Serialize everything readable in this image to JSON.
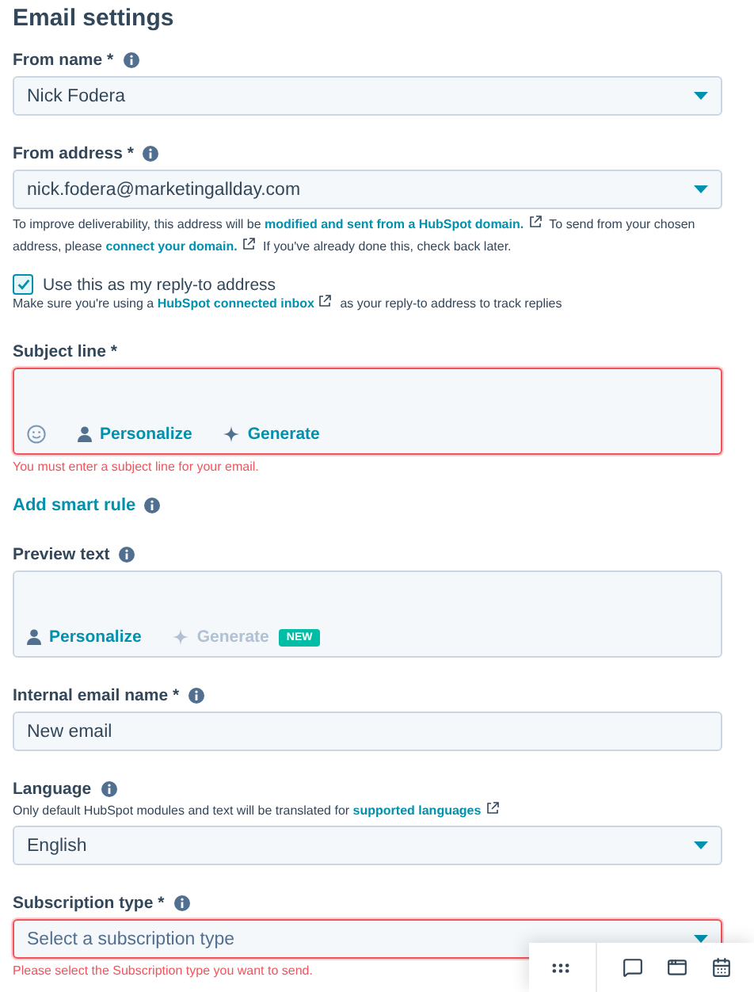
{
  "title": "Email settings",
  "sections": [
    {
      "kind": "select",
      "label": "From name *",
      "info": true,
      "value": "Nick Fodera",
      "invalid": false
    },
    {
      "kind": "select",
      "label": "From address *",
      "info": true,
      "value": "nick.fodera@marketingallday.com",
      "invalid": false,
      "help": [
        {
          "kind": "text",
          "text": "To improve deliverability, this address will be "
        },
        {
          "kind": "link",
          "text": "modified and sent from a HubSpot domain.",
          "external": true
        },
        {
          "kind": "text",
          "text": " To send from your chosen address, please "
        },
        {
          "kind": "link",
          "text": "connect your domain.",
          "external": true
        },
        {
          "kind": "text",
          "text": " If you've already done this, check back later."
        }
      ]
    },
    {
      "kind": "checkbox",
      "label": "Use this as my reply-to address",
      "checked": true,
      "help": [
        {
          "kind": "text",
          "text": "Make sure you're using a "
        },
        {
          "kind": "link",
          "text": "HubSpot connected inbox",
          "external": true
        },
        {
          "kind": "text",
          "text": " as your reply-to address to track replies"
        }
      ]
    },
    {
      "kind": "editor",
      "label": "Subject line *",
      "invalid": true,
      "tools": [
        {
          "kind": "emoji",
          "disabled": false
        },
        {
          "kind": "personalize",
          "label": "Personalize",
          "disabled": false
        },
        {
          "kind": "generate",
          "label": "Generate",
          "disabled": false
        }
      ],
      "error": "You must enter a subject line for your email."
    },
    {
      "kind": "smart_rule",
      "label": "Add smart rule",
      "info": true
    },
    {
      "kind": "editor",
      "label": "Preview text",
      "info": true,
      "invalid": false,
      "tools": [
        {
          "kind": "personalize",
          "label": "Personalize",
          "disabled": false
        },
        {
          "kind": "generate",
          "label": "Generate",
          "disabled": true,
          "badge": "NEW"
        }
      ]
    },
    {
      "kind": "input",
      "label": "Internal email name *",
      "info": true,
      "value": "New email",
      "invalid": false
    },
    {
      "kind": "select",
      "label": "Language",
      "info": true,
      "value": "English",
      "invalid": false,
      "description": [
        {
          "kind": "text",
          "text": "Only default HubSpot modules and text will be translated for "
        },
        {
          "kind": "link",
          "text": "supported languages",
          "external": true
        }
      ]
    },
    {
      "kind": "select",
      "label": "Subscription type *",
      "info": true,
      "placeholder": "Select a subscription type",
      "invalid": true,
      "error": "Please select the Subscription type you want to send."
    }
  ]
}
